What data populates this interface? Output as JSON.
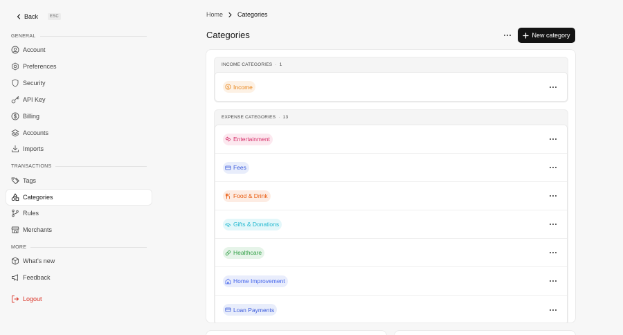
{
  "sidebar": {
    "back_label": "Back",
    "esc_label": "ESC",
    "sections": {
      "general": "GENERAL",
      "transactions": "TRANSACTIONS",
      "more": "MORE"
    },
    "items": [
      {
        "label": "Account",
        "icon": "user-circle-icon"
      },
      {
        "label": "Preferences",
        "icon": "settings-icon"
      },
      {
        "label": "Security",
        "icon": "shield-icon"
      },
      {
        "label": "API Key",
        "icon": "key-icon"
      },
      {
        "label": "Billing",
        "icon": "dollar-circle-icon"
      },
      {
        "label": "Accounts",
        "icon": "layers-icon"
      },
      {
        "label": "Imports",
        "icon": "download-icon"
      },
      {
        "label": "Tags",
        "icon": "tags-icon"
      },
      {
        "label": "Categories",
        "icon": "shapes-icon",
        "active": true
      },
      {
        "label": "Rules",
        "icon": "git-branch-icon"
      },
      {
        "label": "Merchants",
        "icon": "store-icon"
      },
      {
        "label": "What's new",
        "icon": "box-icon"
      },
      {
        "label": "Feedback",
        "icon": "megaphone-icon"
      },
      {
        "label": "Logout",
        "icon": "logout-icon"
      }
    ]
  },
  "breadcrumb": {
    "home": "Home",
    "current": "Categories"
  },
  "header": {
    "title": "Categories",
    "new_button": "New category"
  },
  "income": {
    "title": "INCOME CATEGORIES",
    "count": "1",
    "items": [
      {
        "label": "Income",
        "icon": "coin-icon",
        "color": "#e8851a",
        "bg": "#fdf1e4"
      }
    ]
  },
  "expense": {
    "title": "EXPENSE CATEGORIES",
    "count": "13",
    "items": [
      {
        "label": "Entertainment",
        "icon": "ticket-icon",
        "color": "#d6336c",
        "bg": "#fce8ef"
      },
      {
        "label": "Fees",
        "icon": "credit-card-icon",
        "color": "#3b5bdb",
        "bg": "#e8edfb"
      },
      {
        "label": "Food & Drink",
        "icon": "utensils-icon",
        "color": "#e8590c",
        "bg": "#fdece3"
      },
      {
        "label": "Gifts & Donations",
        "icon": "hand-heart-icon",
        "color": "#22b8cf",
        "bg": "#e3f7fa"
      },
      {
        "label": "Healthcare",
        "icon": "pill-icon",
        "color": "#2f9e44",
        "bg": "#e6f4e9"
      },
      {
        "label": "Home Improvement",
        "icon": "house-icon",
        "color": "#4263eb",
        "bg": "#e9edfc"
      },
      {
        "label": "Loan Payments",
        "icon": "credit-card-icon",
        "color": "#3b5bdb",
        "bg": "#e8edfb"
      }
    ]
  }
}
